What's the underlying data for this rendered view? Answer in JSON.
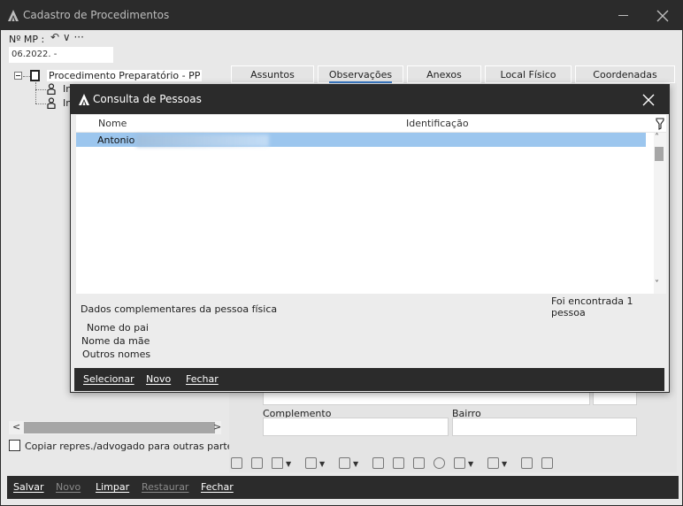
{
  "window": {
    "title": "Cadastro de Procedimentos",
    "minimize_icon": "minimize-icon",
    "close_icon": "close-icon"
  },
  "mp": {
    "label": "Nº MP :",
    "undo_icon": "undo-icon",
    "tools_text": "↶ ∨ ···",
    "value": "06.2022.        -"
  },
  "tree": {
    "root_label": "Procedimento Preparatório - PP",
    "child1": "In",
    "child2": "In"
  },
  "copy_option": {
    "label": "Copiar repres./advogado para outras partes"
  },
  "tabs": [
    {
      "label": "Assuntos"
    },
    {
      "label": "Observações"
    },
    {
      "label": "Anexos"
    },
    {
      "label": "Local Físico"
    },
    {
      "label": "Coordenadas"
    }
  ],
  "address": {
    "complemento_label": "Complemento",
    "bairro_label": "Bairro"
  },
  "bottom": {
    "salvar": "Salvar",
    "novo": "Novo",
    "limpar": "Limpar",
    "restaurar": "Restaurar",
    "fechar": "Fechar"
  },
  "dialog": {
    "title": "Consulta de Pessoas",
    "columns": {
      "nome": "Nome",
      "identificacao": "Identificação"
    },
    "rows": [
      {
        "nome": "Antonio",
        "identificacao": ""
      }
    ],
    "found_text": "Foi encontrada 1 pessoa",
    "dados_title": "Dados complementares da pessoa física",
    "nome_pai_label": "Nome do pai",
    "nome_mae_label": "Nome da mãe",
    "outros_nomes_label": "Outros nomes",
    "selecionar": "Selecionar",
    "novo": "Novo",
    "fechar": "Fechar"
  }
}
